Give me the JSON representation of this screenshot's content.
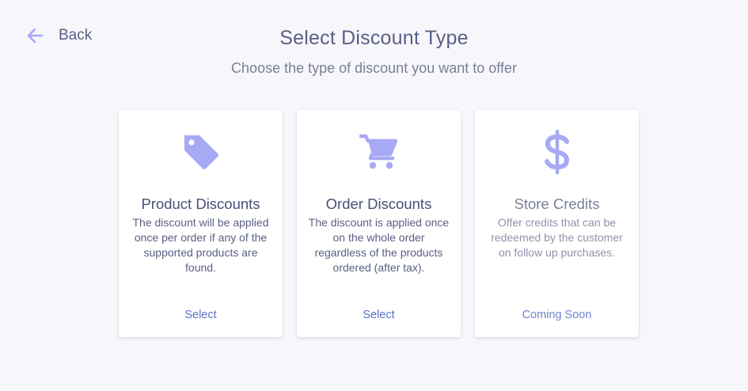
{
  "nav": {
    "back_label": "Back",
    "back_icon": "arrow-left-icon"
  },
  "header": {
    "title": "Select Discount Type",
    "subtitle": "Choose the type of discount you want to offer"
  },
  "cards": [
    {
      "icon": "price-tag-icon",
      "title": "Product Discounts",
      "description": "The discount will be applied once per order if any of the supported products are found.",
      "action": "Select"
    },
    {
      "icon": "shopping-cart-icon",
      "title": "Order Discounts",
      "description": "The discount is applied once on the whole order regardless of the products ordered (after tax).",
      "action": "Select"
    },
    {
      "icon": "dollar-sign-icon",
      "title": "Store Credits",
      "description": "Offer credits that can be redeemed by the customer on follow up purchases.",
      "action": "Coming Soon"
    }
  ],
  "colors": {
    "accent": "#a7a9f4",
    "link": "#5b74c8",
    "background": "#f7f7fb",
    "text": "#4a5079"
  }
}
